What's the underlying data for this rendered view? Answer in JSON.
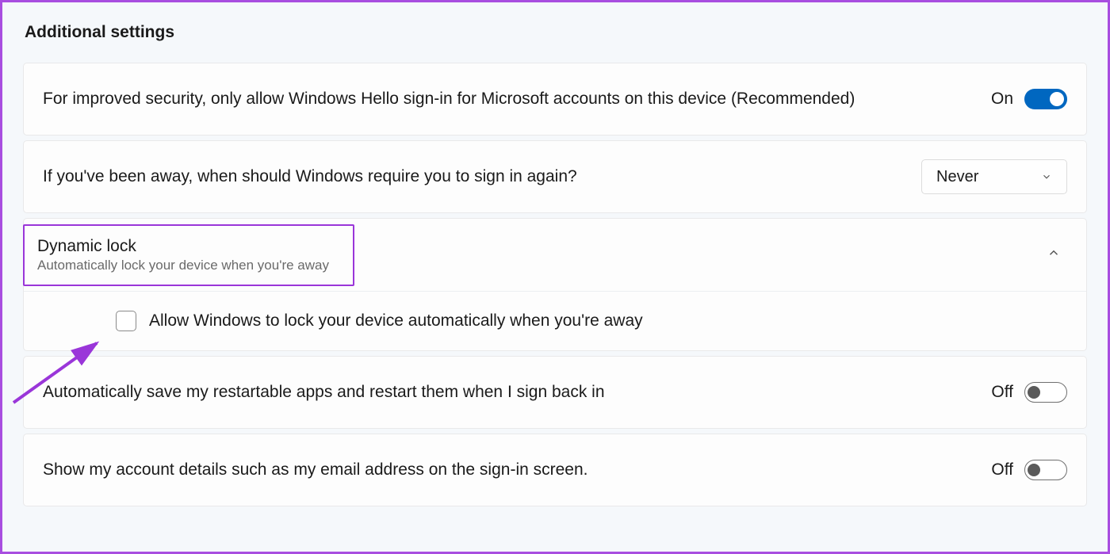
{
  "section_title": "Additional settings",
  "rows": {
    "hello": {
      "label": "For improved security, only allow Windows Hello sign-in for Microsoft accounts on this device (Recommended)",
      "state": "On",
      "toggle": true
    },
    "signin_again": {
      "label": "If you've been away, when should Windows require you to sign in again?",
      "dropdown_value": "Never"
    },
    "dynamic_lock": {
      "title": "Dynamic lock",
      "subtitle": "Automatically lock your device when you're away",
      "checkbox_label": "Allow Windows to lock your device automatically when you're away",
      "checkbox_checked": false,
      "expanded": true
    },
    "restartable_apps": {
      "label": "Automatically save my restartable apps and restart them when I sign back in",
      "state": "Off",
      "toggle": false
    },
    "account_details": {
      "label": "Show my account details such as my email address on the sign-in screen.",
      "state": "Off",
      "toggle": false
    }
  }
}
